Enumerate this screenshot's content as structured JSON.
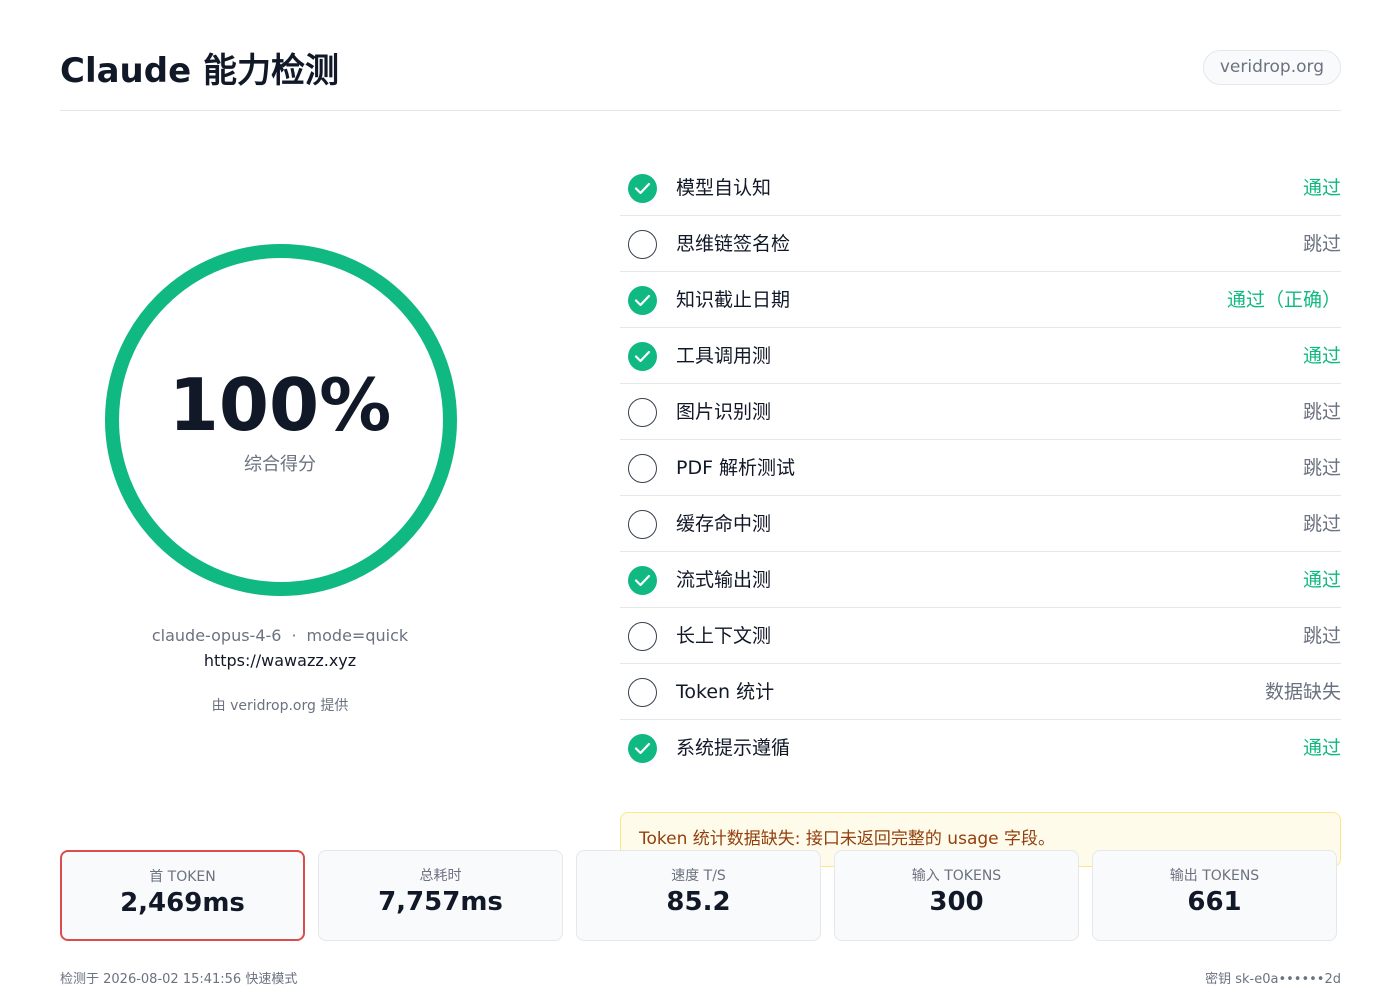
{
  "header": {
    "title": "Claude 能力检测",
    "domain": "veridrop.org"
  },
  "score": {
    "percent": "100%",
    "percent_value": 1.0,
    "label": "综合得分",
    "ring_color": "#10b981"
  },
  "meta": {
    "model": "claude-opus-4-6",
    "mode": "mode=quick",
    "url": "https://wawazz.xyz",
    "by": "由 veridrop.org 提供"
  },
  "checks": [
    {
      "label": "模型自认知",
      "status": "通过",
      "state": "pass"
    },
    {
      "label": "思维链签名检",
      "status": "跳过",
      "state": "fail"
    },
    {
      "label": "知识截止日期",
      "status": "通过（正确）",
      "state": "pass"
    },
    {
      "label": "工具调用测",
      "status": "通过",
      "state": "pass"
    },
    {
      "label": "图片识别测",
      "status": "跳过",
      "state": "fail"
    },
    {
      "label": "PDF 解析测试",
      "status": "跳过",
      "state": "fail"
    },
    {
      "label": "缓存命中测",
      "status": "跳过",
      "state": "fail"
    },
    {
      "label": "流式输出测",
      "status": "通过",
      "state": "pass"
    },
    {
      "label": "长上下文测",
      "status": "跳过",
      "state": "fail"
    },
    {
      "label": "Token 统计",
      "status": "数据缺失",
      "state": "fail"
    },
    {
      "label": "系统提示遵循",
      "status": "通过",
      "state": "pass"
    }
  ],
  "notice": "Token 统计数据缺失: 接口未返回完整的 usage 字段。",
  "stats": [
    {
      "label": "首 TOKEN",
      "value": "2,469ms",
      "highlight": true
    },
    {
      "label": "总耗时",
      "value": "7,757ms",
      "highlight": false
    },
    {
      "label": "速度 T/S",
      "value": "85.2",
      "highlight": false
    },
    {
      "label": "输入 TOKENS",
      "value": "300",
      "highlight": false
    },
    {
      "label": "输出 TOKENS",
      "value": "661",
      "highlight": false
    }
  ],
  "footer": {
    "left": "检测于 2026-08-02 15:41:56 快速模式",
    "right": "密钥 sk-e0a••••••2d"
  }
}
